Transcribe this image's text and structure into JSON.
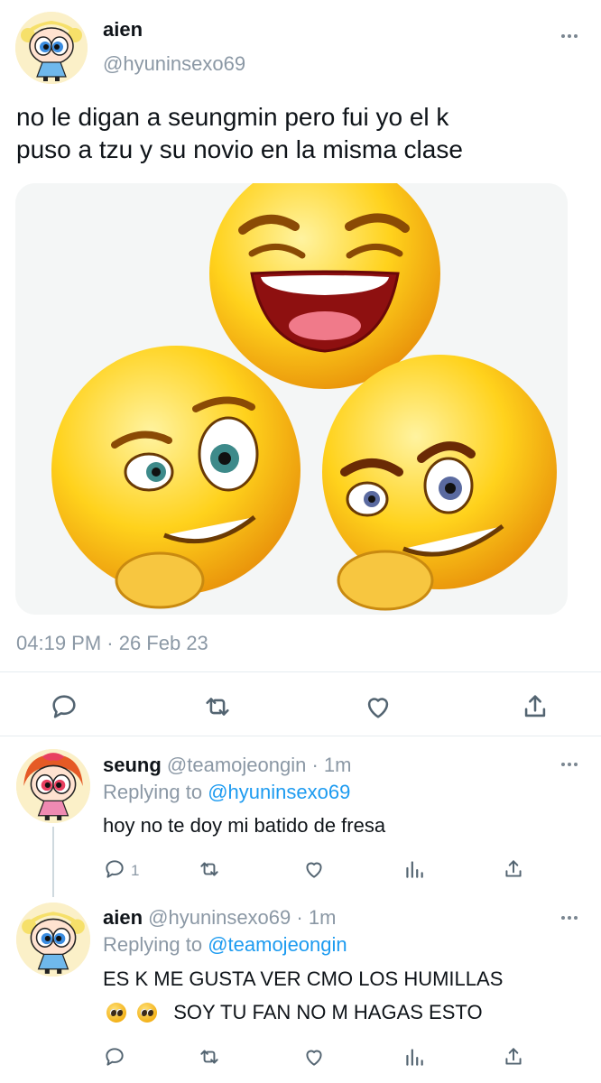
{
  "main_tweet": {
    "display_name": "aien",
    "handle": "@hyuninsexo69",
    "text_line1": "no le digan a seungmin pero fui yo el k",
    "text_line2": "puso a tzu y su novio en la misma clase",
    "timestamp": "04:19 PM · 26 Feb 23",
    "media_description_icon": "three-scheming-emojis"
  },
  "replies": [
    {
      "display_name": "seung",
      "handle": "@teamojeongin",
      "time": "· 1m",
      "replying_prefix": "Replying to",
      "replying_handle": "@hyuninsexo69",
      "text": "hoy no te doy mi batido de fresa",
      "reply_count": "1"
    },
    {
      "display_name": "aien",
      "handle": "@hyuninsexo69",
      "time": "· 1m",
      "replying_prefix": "Replying to",
      "replying_handle": "@teamojeongin",
      "text_line1": "ES K ME GUSTA VER CMO LOS HUMILLAS",
      "text_line2": "SOY TU FAN NO M HAGAS ESTO"
    }
  ],
  "colors": {
    "accent": "#1d9bf0",
    "muted": "#8b98a5",
    "icon": "#536471"
  }
}
